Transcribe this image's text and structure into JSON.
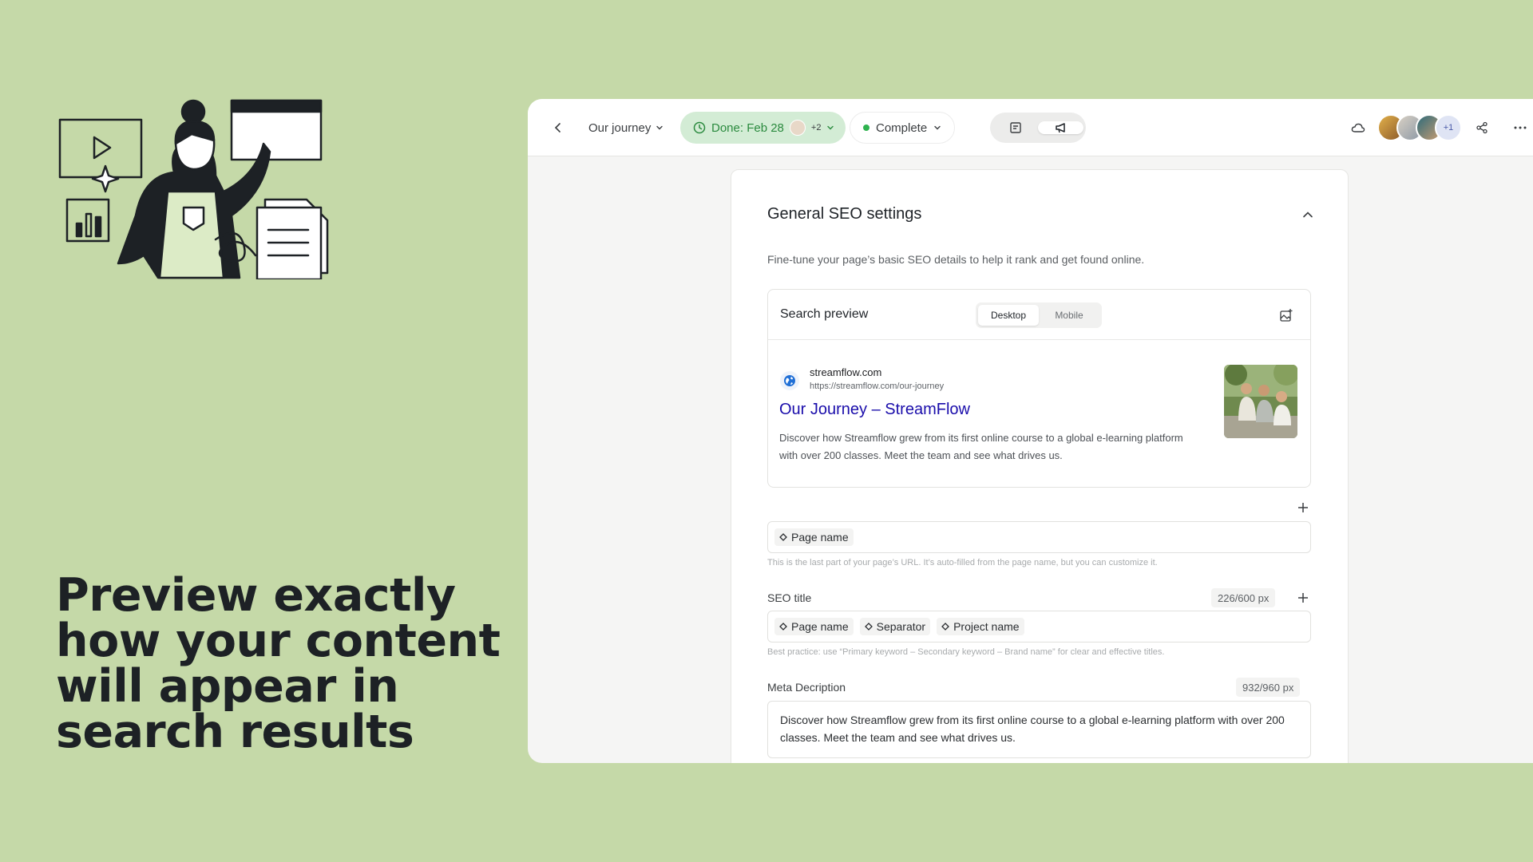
{
  "marketing": {
    "headline_lines": [
      "Preview exactly",
      "how your content",
      "will appear in",
      "search results"
    ]
  },
  "topbar": {
    "page_name": "Our journey",
    "status_label": "Done: Feb 28",
    "assignee_extra": "+2",
    "workflow_status": "Complete",
    "collaborators_extra": "+1"
  },
  "seo": {
    "section_title": "General SEO settings",
    "section_desc": "Fine-tune your page’s basic SEO details to help it rank and get found online.",
    "preview": {
      "title": "Search preview",
      "tabs": [
        "Desktop",
        "Mobile"
      ],
      "active_tab": "Desktop",
      "site_name": "streamflow.com",
      "site_url": "https://streamflow.com/our-journey",
      "result_title": "Our Journey – StreamFlow",
      "result_desc": "Discover how Streamflow grew from its first online course to a global e-learning platform with over 200 classes. Meet the team and see what drives us."
    },
    "slug": {
      "token": "Page name",
      "hint": "This is the last part of your page’s URL. It’s auto-filled from the page name, but you can customize it."
    },
    "seo_title": {
      "label": "SEO title",
      "counter": "226/600 px",
      "tokens": [
        "Page name",
        "Separator",
        "Project name"
      ],
      "hint": "Best practice: use “Primary keyword – Secondary keyword – Brand name” for clear and effective titles."
    },
    "meta": {
      "label": "Meta Decription",
      "counter": "932/960 px",
      "value": "Discover how Streamflow grew from its first online course to a global e-learning platform with over 200 classes. Meet the team and see what drives us."
    }
  },
  "colors": {
    "background": "#c5d9a8",
    "status_pill": "#d3ecd5",
    "status_text": "#2a8a3e",
    "link_blue": "#1a0dab"
  },
  "icons": [
    "back-icon",
    "chevron-down-icon",
    "clock-icon",
    "document-icon",
    "megaphone-icon",
    "cloud-icon",
    "share-icon",
    "more-icon",
    "chevron-up-icon",
    "add-image-icon",
    "globe-icon",
    "plus-icon",
    "diamond-icon"
  ]
}
